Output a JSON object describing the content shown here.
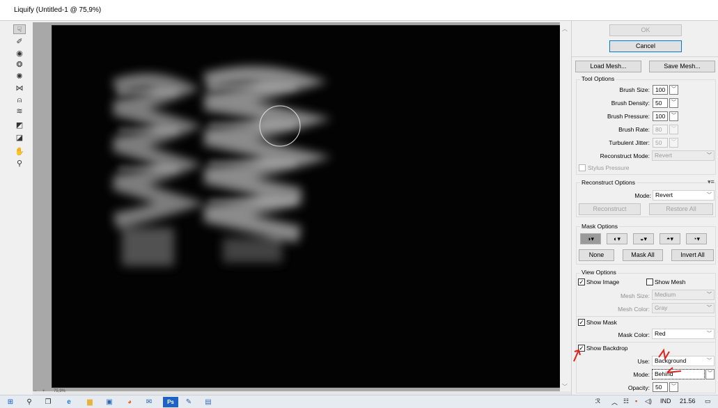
{
  "window": {
    "title": "Liquify (Untitled-1 @ 75,9%)"
  },
  "toolbar": {
    "tools": [
      {
        "icon": "forward-warp-icon",
        "glyph": "☟"
      },
      {
        "icon": "reconstruct-icon",
        "glyph": "✐"
      },
      {
        "icon": "twirl-clockwise-icon",
        "glyph": "◉"
      },
      {
        "icon": "pucker-icon",
        "glyph": "❂"
      },
      {
        "icon": "bloat-icon",
        "glyph": "✺"
      },
      {
        "icon": "push-left-icon",
        "glyph": "⋈"
      },
      {
        "icon": "mirror-icon",
        "glyph": "⍝"
      },
      {
        "icon": "turbulence-icon",
        "glyph": "≋"
      },
      {
        "icon": "freeze-mask-icon",
        "glyph": "◩"
      },
      {
        "icon": "thaw-mask-icon",
        "glyph": "◪"
      },
      {
        "icon": "hand-icon",
        "glyph": "✋"
      },
      {
        "icon": "zoom-icon",
        "glyph": "⚲"
      }
    ]
  },
  "canvas": {
    "zoom_label": "75,9%"
  },
  "panel": {
    "ok_label": "OK",
    "cancel_label": "Cancel",
    "load_mesh_label": "Load Mesh...",
    "save_mesh_label": "Save Mesh...",
    "tool_options": {
      "title": "Tool Options",
      "brush_size_label": "Brush Size:",
      "brush_size_value": "100",
      "brush_density_label": "Brush Density:",
      "brush_density_value": "50",
      "brush_pressure_label": "Brush Pressure:",
      "brush_pressure_value": "100",
      "brush_rate_label": "Brush Rate:",
      "brush_rate_value": "80",
      "turbulent_jitter_label": "Turbulent Jitter:",
      "turbulent_jitter_value": "50",
      "reconstruct_mode_label": "Reconstruct Mode:",
      "reconstruct_mode_value": "Revert",
      "stylus_pressure_label": "Stylus Pressure"
    },
    "reconstruct_options": {
      "title": "Reconstruct Options",
      "mode_label": "Mode:",
      "mode_value": "Revert",
      "reconstruct_label": "Reconstruct",
      "restore_all_label": "Restore All"
    },
    "mask_options": {
      "title": "Mask Options",
      "mode_glyphs": [
        "◑▾",
        "◐▾",
        "◒▾",
        "◓▾",
        "◔▾"
      ],
      "none_label": "None",
      "mask_all_label": "Mask All",
      "invert_all_label": "Invert All"
    },
    "view_options": {
      "title": "View Options",
      "show_image_label": "Show Image",
      "show_mesh_label": "Show Mesh",
      "mesh_size_label": "Mesh Size:",
      "mesh_size_value": "Medium",
      "mesh_color_label": "Mesh Color:",
      "mesh_color_value": "Gray",
      "show_mask_label": "Show Mask",
      "mask_color_label": "Mask Color:",
      "mask_color_value": "Red",
      "show_backdrop_label": "Show Backdrop",
      "use_label": "Use:",
      "use_value": "Background",
      "mode_label": "Mode:",
      "mode_value": "Behind",
      "opacity_label": "Opacity:",
      "opacity_value": "50"
    }
  },
  "taskbar": {
    "apps": [
      {
        "icon": "windows-start-icon",
        "glyph": "⊞"
      },
      {
        "icon": "search-icon",
        "glyph": "⚲"
      },
      {
        "icon": "task-view-icon",
        "glyph": "❐"
      },
      {
        "icon": "edge-browser-icon",
        "glyph": "e"
      },
      {
        "icon": "file-explorer-icon",
        "glyph": "▆"
      },
      {
        "icon": "store-icon",
        "glyph": "▣"
      },
      {
        "icon": "firefox-icon",
        "glyph": "◕"
      },
      {
        "icon": "mail-icon",
        "glyph": "✉"
      },
      {
        "icon": "photoshop-icon",
        "glyph": "Ps"
      },
      {
        "icon": "paint-icon",
        "glyph": "✎"
      },
      {
        "icon": "app-icon",
        "glyph": "▤"
      }
    ],
    "tray_language": "IND",
    "tray_time": "21.56"
  },
  "colors": {
    "annotation": "#e0241b",
    "canvas_bg": "#030303",
    "accent": "#0078d7"
  }
}
